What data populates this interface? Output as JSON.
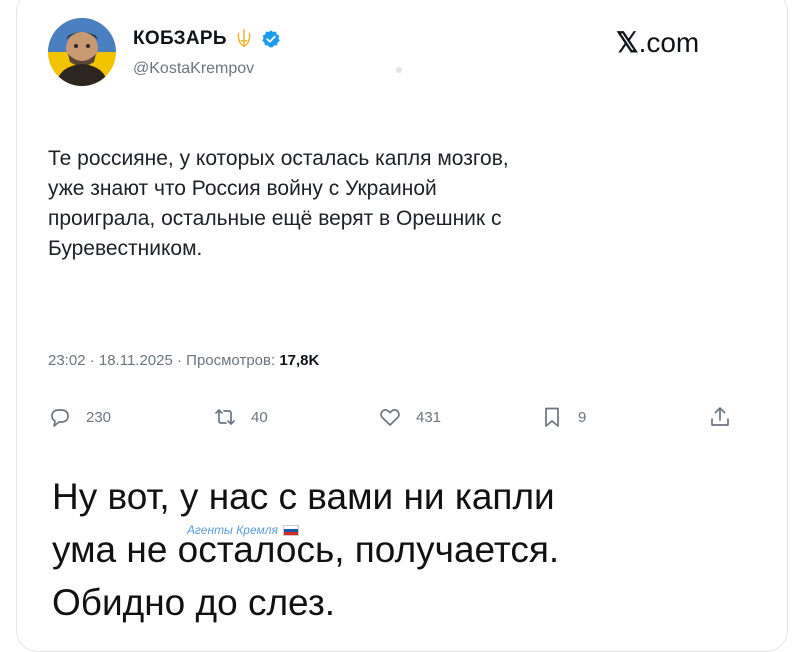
{
  "tweet": {
    "display_name": "КОБЗАРЬ",
    "handle": "@KostaKrempov",
    "site_prefix": "𝕏",
    "site_suffix": ".com",
    "text": "Те россияне, у которых осталась капля мозгов,\nуже знают что Россия войну с Украиной\nпроиграла, остальные ещё верят в Орешник с\nБуревестником.",
    "timestamp": "23:02 · 18.11.2025 · Просмотров: ",
    "views": "17,8K",
    "actions": {
      "replies": "230",
      "reposts": "40",
      "likes": "431",
      "bookmarks": "9"
    }
  },
  "caption": {
    "text": "Ну вот, у нас с вами ни капли\nума не осталось, получается.\nОбидно до слез."
  },
  "watermark": {
    "text": "Агенты Кремля"
  },
  "colors": {
    "verified": "#1d9bf0",
    "trident": "#e8b62c",
    "muted": "#6b7680",
    "watermark": "#5b9bd5"
  },
  "icons": [
    "avatar-portrait",
    "trident-icon",
    "verified-icon",
    "reply-icon",
    "repost-icon",
    "like-icon",
    "bookmark-icon",
    "share-icon",
    "russia-flag-icon"
  ]
}
